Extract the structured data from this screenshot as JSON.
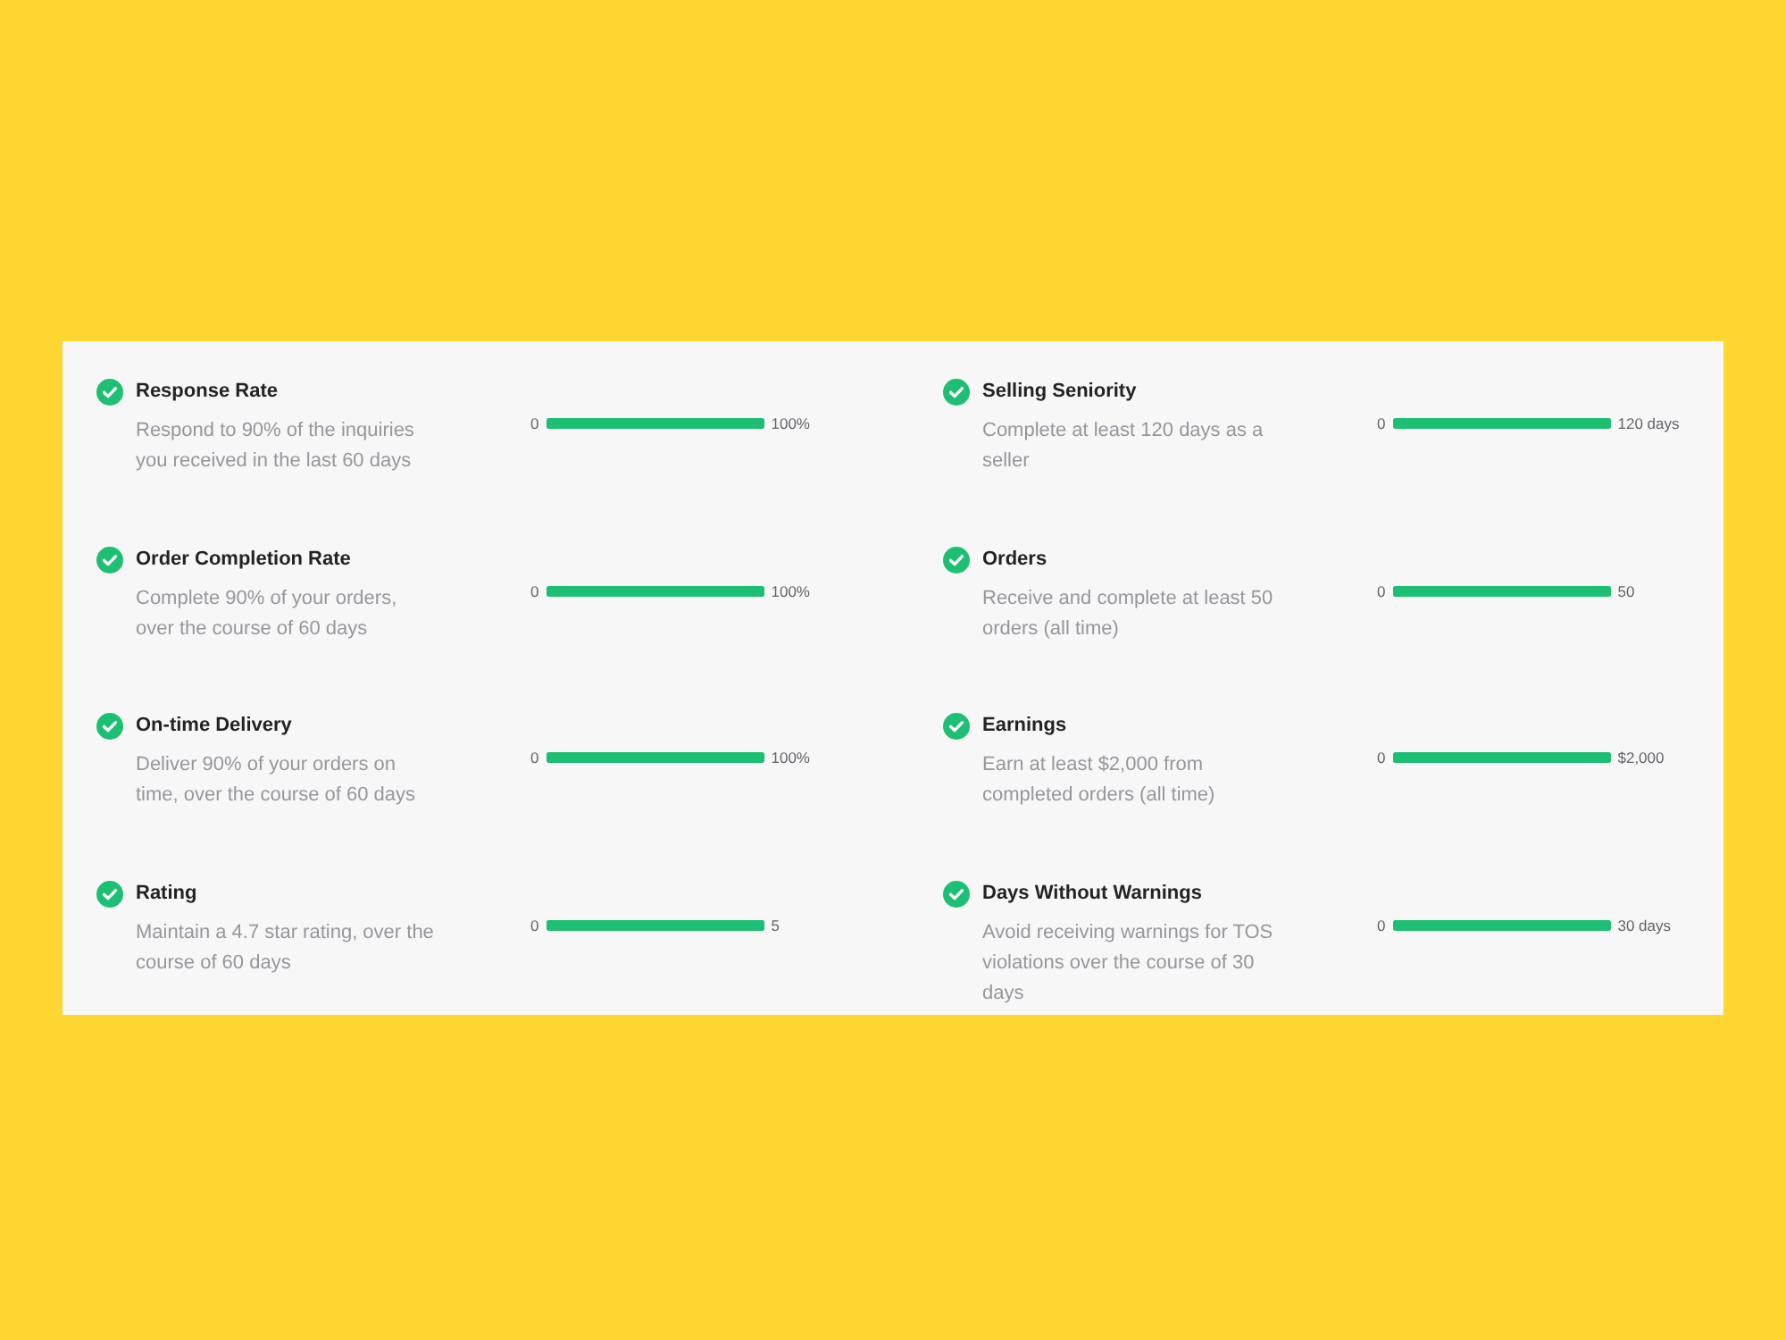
{
  "panel": {
    "columns": [
      {
        "items": [
          {
            "title": "Response Rate",
            "description": "Respond to 90% of the inquiries you received in the last 60 days",
            "completed": true,
            "bar": {
              "min_label": "0",
              "level": 1,
              "max_label": "100%"
            }
          },
          {
            "title": "Order Completion Rate",
            "description": "Complete 90% of your orders, over the course of 60 days",
            "completed": true,
            "bar": {
              "min_label": "0",
              "level": 1,
              "max_label": "100%"
            }
          },
          {
            "title": "On-time Delivery",
            "description": "Deliver 90% of your orders on time, over the course of 60 days",
            "completed": true,
            "bar": {
              "min_label": "0",
              "level": 1,
              "max_label": "100%"
            }
          },
          {
            "title": "Rating",
            "description": "Maintain a 4.7 star rating, over the course of 60 days",
            "completed": true,
            "bar": {
              "min_label": "0",
              "level": 1,
              "max_label": "5"
            }
          }
        ]
      },
      {
        "items": [
          {
            "title": "Selling Seniority",
            "description": "Complete at least 120 days as a seller",
            "completed": true,
            "bar": {
              "min_label": "0",
              "level": 1,
              "max_label": "120 days"
            }
          },
          {
            "title": "Orders",
            "description": "Receive and complete at least 50 orders (all time)",
            "completed": true,
            "bar": {
              "min_label": "0",
              "level": 1,
              "max_label": "50"
            }
          },
          {
            "title": "Earnings",
            "description": "Earn at least $2,000 from completed orders (all time)",
            "completed": true,
            "bar": {
              "min_label": "0",
              "level": 1,
              "max_label": "$2,000"
            }
          },
          {
            "title": "Days Without Warnings",
            "description": "Avoid receiving warnings for TOS violations over the course of 30 days",
            "completed": true,
            "bar": {
              "min_label": "0",
              "level": 1,
              "max_label": "30 days"
            }
          }
        ]
      }
    ]
  }
}
